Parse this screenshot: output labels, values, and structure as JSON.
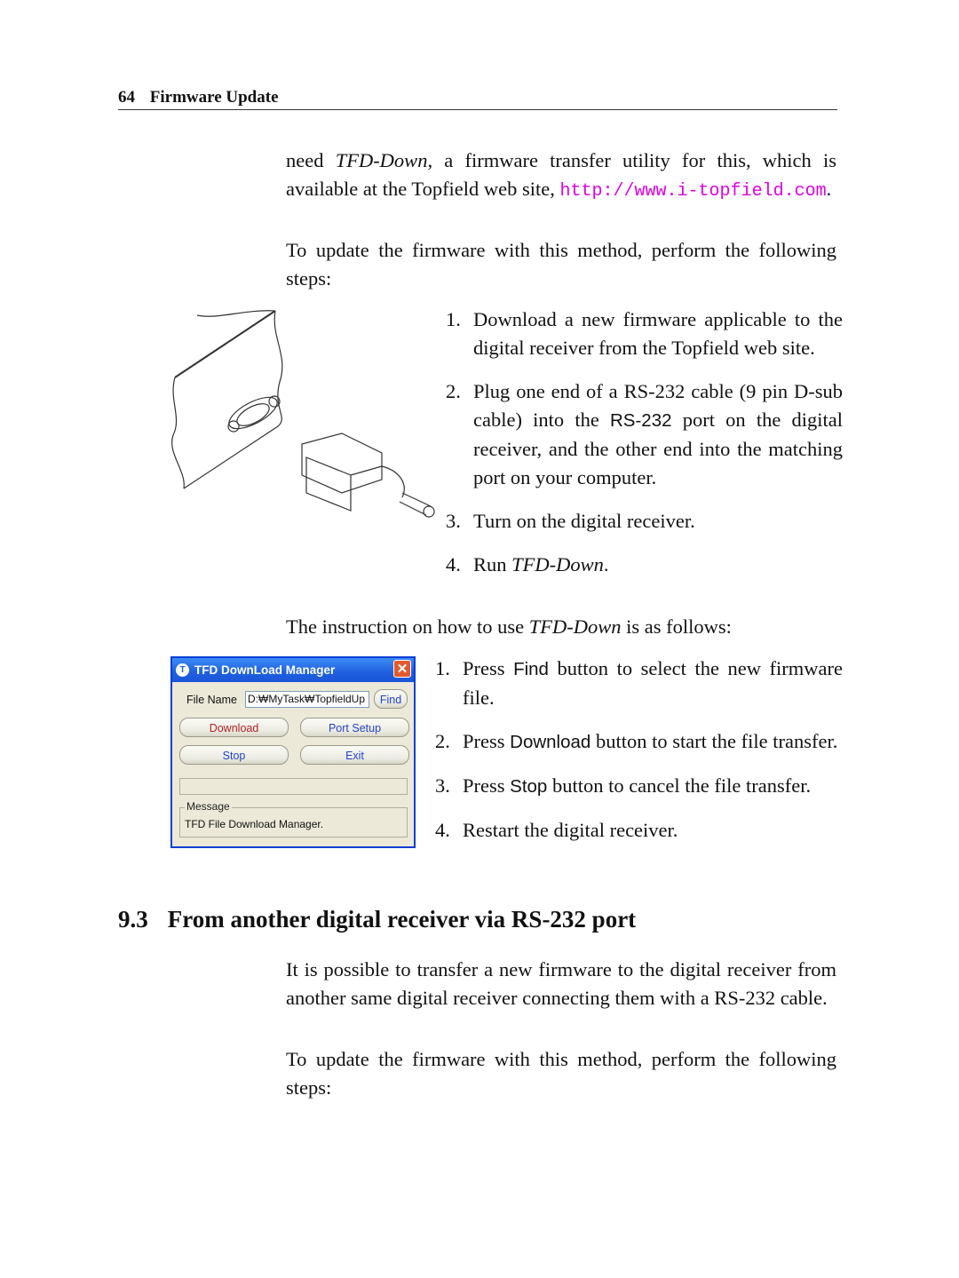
{
  "header": {
    "page_number": "64",
    "chapter": "Firmware Update"
  },
  "intro": {
    "p1_pre": "need ",
    "p1_tool": "TFD-Down",
    "p1_mid": ", a firmware transfer utility for this, which is available at the Topfield web site, ",
    "p1_url": "http://www.i-topfield.com",
    "p1_post": ".",
    "p2": "To update the firmware with this method, perform the following steps:"
  },
  "steps_a": [
    {
      "n": "1.",
      "text": "Download a new firmware applicable to the digital receiver from the Topfield web site."
    },
    {
      "n": "2.",
      "pre": "Plug one end of a RS-232 cable (9 pin D-sub cable) into the ",
      "kw": "RS-232",
      "post": " port on the digital receiver, and the other end into the matching port on your computer."
    },
    {
      "n": "3.",
      "text": "Turn on the digital receiver."
    },
    {
      "n": "4.",
      "pre": "Run ",
      "italic": "TFD-Down",
      "post": "."
    }
  ],
  "instruction": {
    "pre": "The instruction on how to use ",
    "italic": "TFD-Down",
    "post": " is as follows:"
  },
  "steps_b": [
    {
      "n": "1.",
      "pre": "Press ",
      "kw": "Find",
      "post": " button to select the new firmware file."
    },
    {
      "n": "2.",
      "pre": "Press ",
      "kw": "Download",
      "post": " button to start the file transfer."
    },
    {
      "n": "3.",
      "pre": "Press ",
      "kw": "Stop",
      "post": " button to cancel the file transfer."
    },
    {
      "n": "4.",
      "text": "Restart the digital receiver."
    }
  ],
  "dialog": {
    "title": "TFD DownLoad Manager",
    "icon": "tfd-logo-icon",
    "close": "✕",
    "file_name_label": "File Name",
    "file_name_value": "D:₩MyTask₩TopfieldUp",
    "find": "Find",
    "download": "Download",
    "port_setup": "Port Setup",
    "stop": "Stop",
    "exit": "Exit",
    "message_label": "Message",
    "message_text": "TFD File Download Manager.",
    "colors": {
      "download_text": "#b22222",
      "button_text": "#2244cc",
      "titlebar": "#1f5fe0"
    }
  },
  "section": {
    "number": "9.3",
    "title": "From another digital receiver via RS-232 port",
    "p1": "It is possible to transfer a new firmware to the digital receiver from another same digital receiver connecting them with a RS-232 cable.",
    "p2": "To update the firmware with this method, perform the following steps:"
  },
  "figure": {
    "icon": "rs232-connector-illustration"
  }
}
